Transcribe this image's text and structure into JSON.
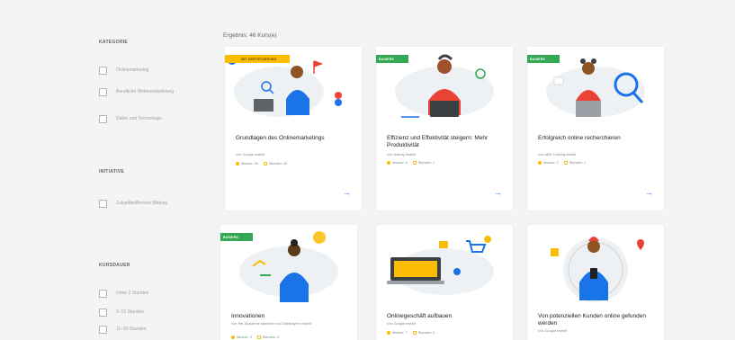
{
  "filters": {
    "sections": [
      {
        "heading": "KATEGORIE",
        "options": [
          "Onlinemarketing",
          "Berufliche Weiterentwicklung",
          "Daten und Technologie"
        ]
      },
      {
        "heading": "INITIATIVE",
        "options": [
          "Zukunftsoffensive Bildung"
        ]
      },
      {
        "heading": "KURSDAUER",
        "options": [
          "Unter 3 Stunden",
          "3–10 Stunden",
          "11–20 Stunden"
        ]
      }
    ]
  },
  "results_label": "Ergebnis: 46 Kurs(e)",
  "cards": [
    {
      "badge": "MIT ZERTIFIZIERUNG",
      "badge_color": "#fbbc04",
      "title": "Grundlagen des Onlinemarketings",
      "provider": "Von Google erstellt",
      "modules": "Module: 26",
      "hours": "Stunden: 40",
      "arrow": "→",
      "illus": "person-laptop-blue"
    },
    {
      "badge": "BASIERS",
      "badge_color": "#34a853",
      "title": "Effizienz und Effektivität steigern: Mehr Produktivität",
      "provider": "Von Udemy erstellt",
      "modules": "Module: 6",
      "hours": "Stunden: 1",
      "arrow": "→",
      "illus": "person-laptop-red"
    },
    {
      "badge": "BASIERS",
      "badge_color": "#34a853",
      "title": "Erfolgreich online recherchieren",
      "provider": "Von ARD Training erstellt",
      "modules": "Module: 1",
      "hours": "Stunden: 1",
      "arrow": "→",
      "illus": "person-search"
    },
    {
      "badge": "BASIERS",
      "badge_color": "#34a853",
      "title": "Innovationen",
      "provider": "Von IHK Akademie München und Oberbayern erstellt",
      "modules": "Module: 3",
      "hours": "Stunden: 3",
      "arrow": "→",
      "illus": "person-idea"
    },
    {
      "badge": "",
      "badge_color": "",
      "title": "Onlinegeschäft aufbauen",
      "provider": "Von Google erstellt",
      "modules": "Module: 7",
      "hours": "Stunden: 3",
      "arrow": "→",
      "illus": "online-shop"
    },
    {
      "badge": "",
      "badge_color": "",
      "title": "Von potenziellen Kunden online gefunden werden",
      "provider": "Von Google erstellt",
      "modules": "Module: 5",
      "hours": "Stunden: 3",
      "arrow": "→",
      "illus": "person-phone"
    }
  ]
}
